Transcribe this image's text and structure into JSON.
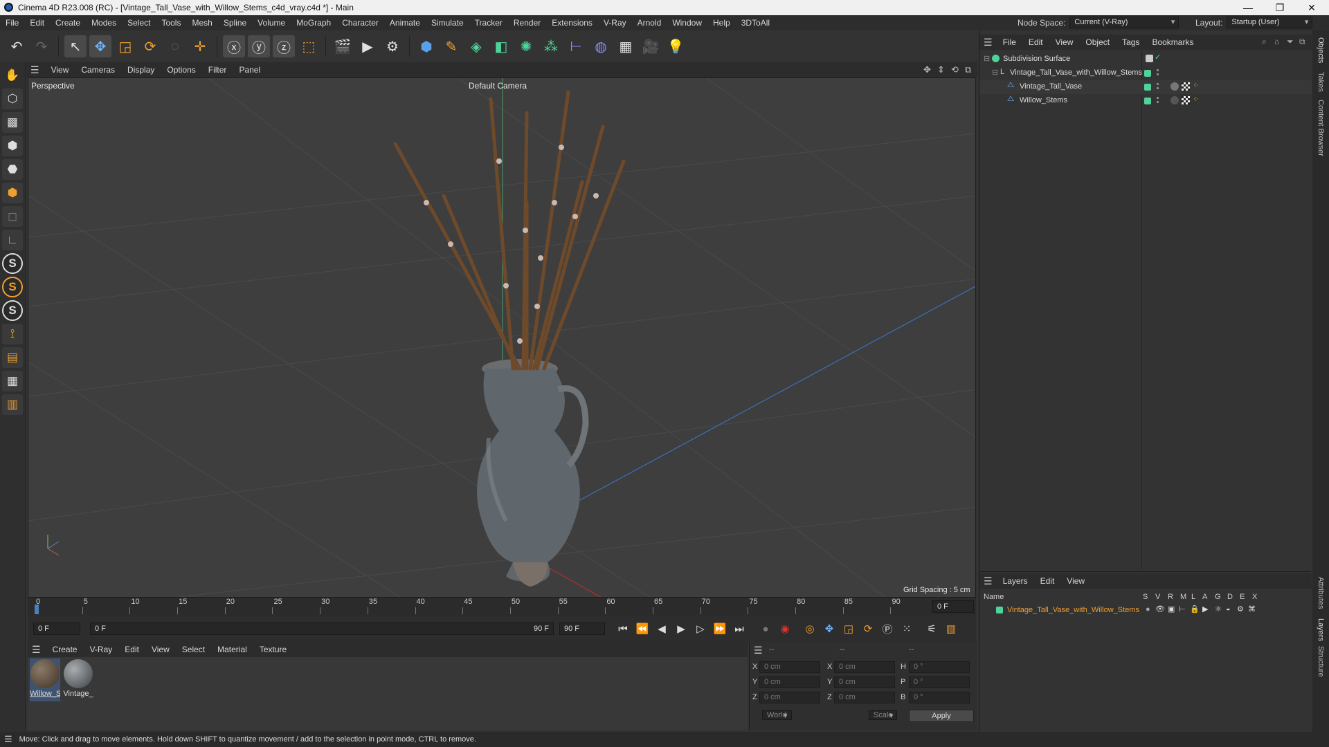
{
  "window": {
    "title": "Cinema 4D R23.008 (RC) - [Vintage_Tall_Vase_with_Willow_Stems_c4d_vray.c4d *] - Main",
    "controls": [
      "—",
      "❐",
      "✕"
    ]
  },
  "menubar": {
    "items": [
      "File",
      "Edit",
      "Create",
      "Modes",
      "Select",
      "Tools",
      "Mesh",
      "Spline",
      "Volume",
      "MoGraph",
      "Character",
      "Animate",
      "Simulate",
      "Tracker",
      "Render",
      "Extensions",
      "V-Ray",
      "Arnold",
      "Window",
      "Help",
      "3DToAll"
    ],
    "node_space_label": "Node Space:",
    "node_space_value": "Current (V-Ray)",
    "layout_label": "Layout:",
    "layout_value": "Startup (User)"
  },
  "viewport": {
    "menu": [
      "View",
      "Cameras",
      "Display",
      "Options",
      "Filter",
      "Panel"
    ],
    "view_name": "Perspective",
    "camera_name": "Default Camera",
    "grid_spacing": "Grid Spacing : 5 cm"
  },
  "timeline": {
    "ticks": [
      "0",
      "5",
      "10",
      "15",
      "20",
      "25",
      "30",
      "35",
      "40",
      "45",
      "50",
      "55",
      "60",
      "65",
      "70",
      "75",
      "80",
      "85",
      "90"
    ],
    "current_frame": "0 F",
    "start_field": "0 F",
    "range_start": "0 F",
    "range_end": "90 F",
    "end_field": "90 F"
  },
  "material_manager": {
    "menu": [
      "Create",
      "V-Ray",
      "Edit",
      "View",
      "Select",
      "Material",
      "Texture"
    ],
    "materials": [
      {
        "name": "Willow_S",
        "color": "#5a4a3c"
      },
      {
        "name": "Vintage_",
        "color": "#6b7075"
      }
    ]
  },
  "coordinates": {
    "headers": [
      "--",
      "--",
      "--"
    ],
    "rows": [
      {
        "axis": "X",
        "pos": "0 cm",
        "size_axis": "X",
        "size": "0 cm",
        "rot_axis": "H",
        "rot": "0 °"
      },
      {
        "axis": "Y",
        "pos": "0 cm",
        "size_axis": "Y",
        "size": "0 cm",
        "rot_axis": "P",
        "rot": "0 °"
      },
      {
        "axis": "Z",
        "pos": "0 cm",
        "size_axis": "Z",
        "size": "0 cm",
        "rot_axis": "B",
        "rot": "0 °"
      }
    ],
    "space": "World",
    "mode": "Scale",
    "apply_label": "Apply"
  },
  "object_manager": {
    "menu": [
      "File",
      "Edit",
      "View",
      "Object",
      "Tags",
      "Bookmarks"
    ],
    "objects": [
      {
        "name": "Subdivision Surface",
        "level": 0
      },
      {
        "name": "Vintage_Tall_Vase_with_Willow_Stems",
        "level": 1
      },
      {
        "name": "Vintage_Tall_Vase",
        "level": 2
      },
      {
        "name": "Willow_Stems",
        "level": 2
      }
    ]
  },
  "layer_manager": {
    "menu": [
      "Layers",
      "Edit",
      "View"
    ],
    "name_header": "Name",
    "flags": [
      "S",
      "V",
      "R",
      "M",
      "L",
      "A",
      "G",
      "D",
      "E",
      "X"
    ],
    "layer_name": "Vintage_Tall_Vase_with_Willow_Stems",
    "layer_color": "#4fd39a"
  },
  "side_tabs": [
    "Objects",
    "Takes",
    "Content Browser",
    "Attributes",
    "Layers",
    "Structure"
  ],
  "status": "Move: Click and drag to move elements. Hold down SHIFT to quantize movement / add to the selection in point mode, CTRL to remove."
}
